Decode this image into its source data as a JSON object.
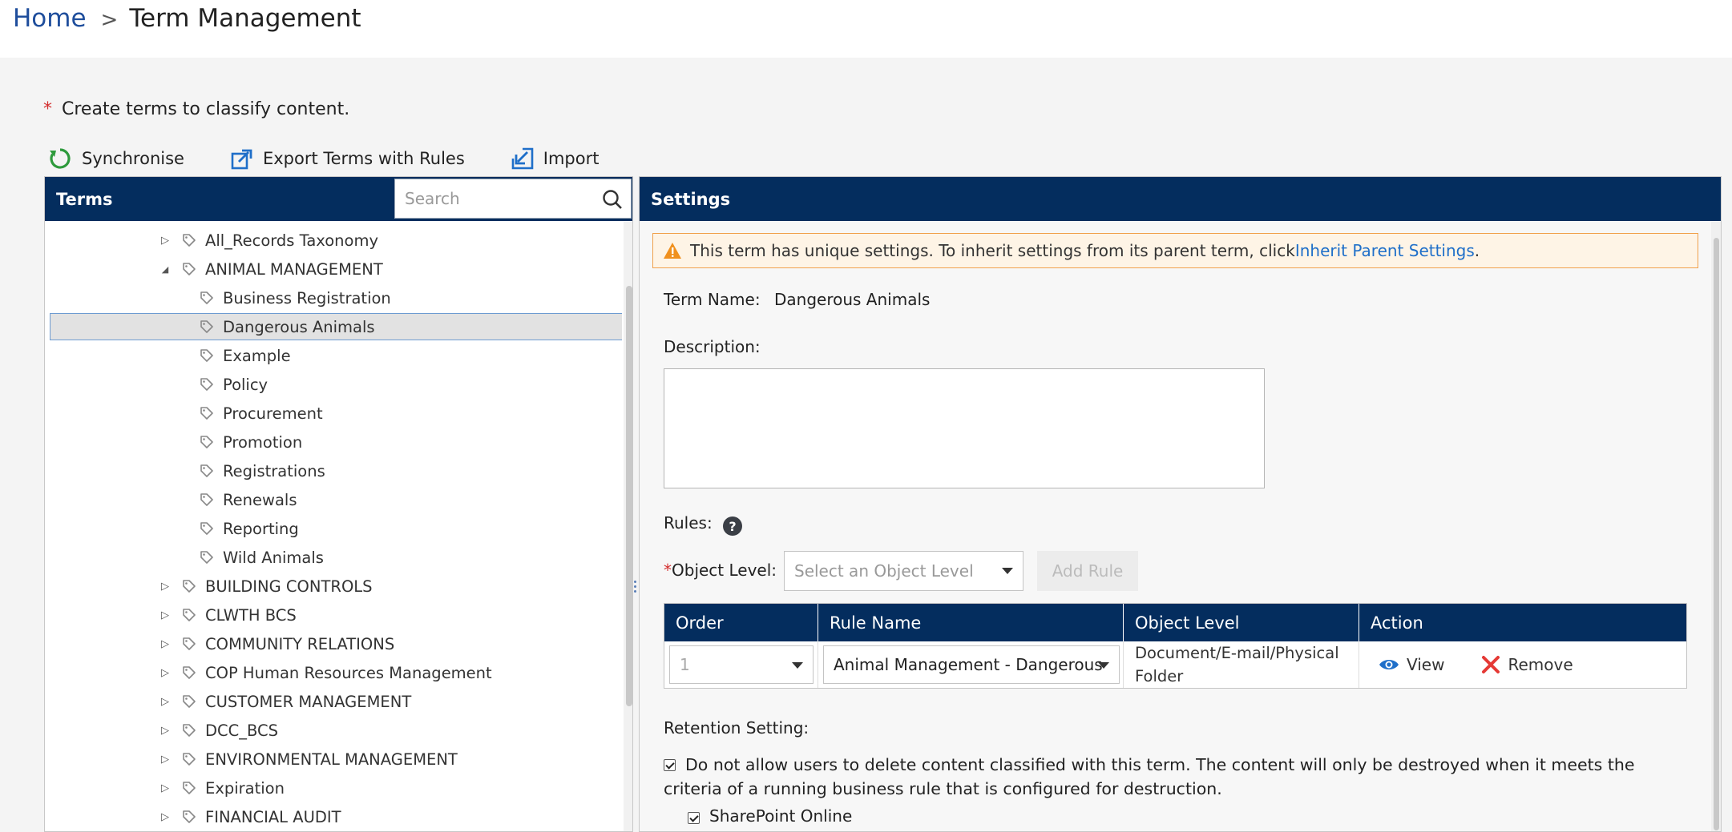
{
  "breadcrumb": {
    "home": "Home",
    "separator": ">",
    "current": "Term Management"
  },
  "intro": {
    "required_marker": "*",
    "text": "Create terms to classify content."
  },
  "toolbar": {
    "synchronise": "Synchronise",
    "export": "Export Terms with Rules",
    "import": "Import"
  },
  "terms_panel": {
    "title": "Terms",
    "search_placeholder": "Search",
    "partial_item": "...",
    "items": [
      {
        "label": "All_Records Taxonomy",
        "level": 1,
        "toggle": "collapsed"
      },
      {
        "label": "ANIMAL MANAGEMENT",
        "level": 1,
        "toggle": "expanded"
      },
      {
        "label": "Business Registration",
        "level": 2
      },
      {
        "label": "Dangerous Animals",
        "level": 2,
        "selected": true
      },
      {
        "label": "Example",
        "level": 2
      },
      {
        "label": "Policy",
        "level": 2
      },
      {
        "label": "Procurement",
        "level": 2
      },
      {
        "label": "Promotion",
        "level": 2
      },
      {
        "label": "Registrations",
        "level": 2
      },
      {
        "label": "Renewals",
        "level": 2
      },
      {
        "label": "Reporting",
        "level": 2
      },
      {
        "label": "Wild Animals",
        "level": 2
      },
      {
        "label": "BUILDING CONTROLS",
        "level": 1,
        "toggle": "collapsed"
      },
      {
        "label": "CLWTH BCS",
        "level": 1,
        "toggle": "collapsed"
      },
      {
        "label": "COMMUNITY RELATIONS",
        "level": 1,
        "toggle": "collapsed"
      },
      {
        "label": "COP Human Resources Management",
        "level": 1,
        "toggle": "collapsed"
      },
      {
        "label": "CUSTOMER MANAGEMENT",
        "level": 1,
        "toggle": "collapsed"
      },
      {
        "label": "DCC_BCS",
        "level": 1,
        "toggle": "collapsed"
      },
      {
        "label": "ENVIRONMENTAL MANAGEMENT",
        "level": 1,
        "toggle": "collapsed"
      },
      {
        "label": "Expiration",
        "level": 1,
        "toggle": "collapsed"
      },
      {
        "label": "FINANCIAL AUDIT",
        "level": 1,
        "toggle": "collapsed"
      }
    ]
  },
  "settings": {
    "title": "Settings",
    "warning": {
      "text": "This term has unique settings. To inherit settings from its parent term, click ",
      "link": "Inherit Parent Settings",
      "suffix": "."
    },
    "term_name_label": "Term Name:",
    "term_name_value": "Dangerous Animals",
    "description_label": "Description:",
    "description_value": "",
    "rules_label": "Rules:",
    "help_glyph": "?",
    "object_level_required": "*",
    "object_level_label": "Object Level:",
    "object_level_placeholder": "Select an Object Level",
    "add_rule": "Add Rule",
    "table": {
      "headers": [
        "Order",
        "Rule Name",
        "Object Level",
        "Action"
      ],
      "rows": [
        {
          "order": "1",
          "rule_name": "Animal Management - Dangerous",
          "object_level": "Document/E-mail/Physical Folder",
          "view": "View",
          "remove": "Remove"
        }
      ]
    },
    "retention_label": "Retention Setting:",
    "retention_text": "Do not allow users to delete content classified with this term. The content will only be destroyed when it meets the criteria of a running business rule that is configured for destruction.",
    "retention_checked": true,
    "sharepoint_label": "SharePoint Online",
    "sharepoint_checked": true
  },
  "colors": {
    "header_bg": "#042d5e",
    "link": "#1f4e9c",
    "warning_bg": "#fef4e6",
    "warning_border": "#f0a04b",
    "remove_icon": "#e53935",
    "view_icon": "#1f6fc9",
    "sync_icon": "#2e9a3c"
  }
}
